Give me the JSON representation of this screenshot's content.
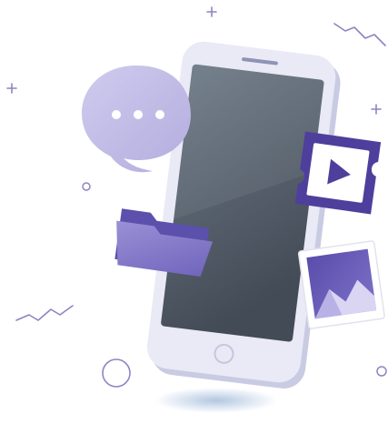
{
  "illustration": {
    "subject": "smartphone-with-media-icons",
    "icons": [
      "chat-bubble-icon",
      "folder-icon",
      "video-ticket-icon",
      "image-photo-icon"
    ],
    "colors": {
      "phone_frame": "#e7e8f5",
      "phone_frame_shade": "#c9cbe3",
      "screen_top": "#66727f",
      "screen_bottom": "#48505b",
      "accent_purple": "#4f3f9c",
      "light_purple": "#c7c3ea",
      "mid_purple": "#8177c9",
      "decor_line": "#8a86c2",
      "shadow": "#b9cde3"
    }
  }
}
